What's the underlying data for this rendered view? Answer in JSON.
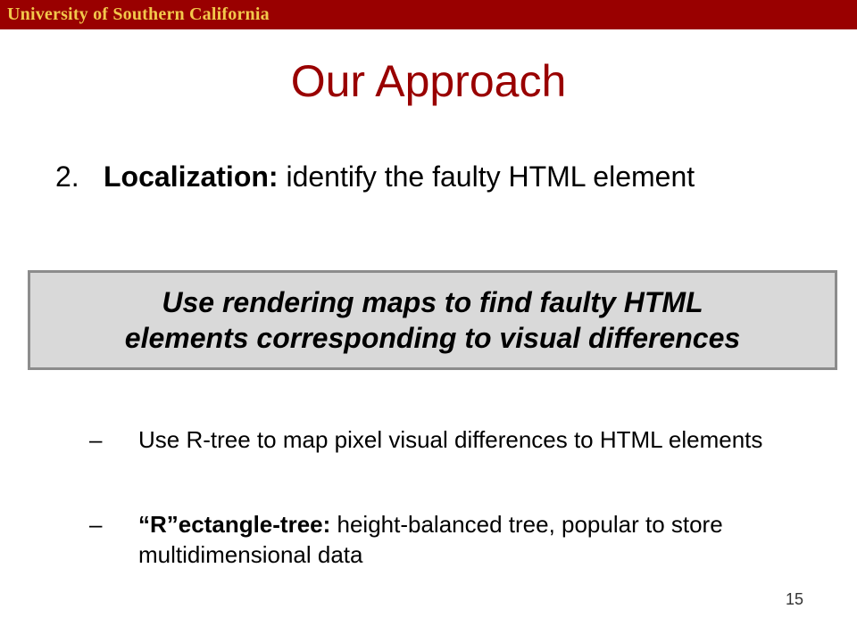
{
  "header": {
    "institution": "University of Southern California",
    "bar_color": "#990000",
    "text_color": "#f2c84b"
  },
  "slide": {
    "title": "Our Approach",
    "title_color": "#990000",
    "point": {
      "number": "2.",
      "term": "Localization:",
      "text": " identify the faulty HTML element"
    },
    "callout": {
      "line1": "Use rendering maps to find faulty HTML",
      "line2": "elements corresponding to visual differences",
      "background_color": "#d9d9d9",
      "border_color": "#8c8c8c"
    },
    "subpoints": [
      {
        "dash": "–",
        "term": "",
        "text": "Use R-tree to map pixel visual differences to HTML elements"
      },
      {
        "dash": "–",
        "term": "“R”ectangle-tree:",
        "text": " height-balanced tree, popular to store multidimensional data"
      }
    ],
    "page_number": "15"
  }
}
